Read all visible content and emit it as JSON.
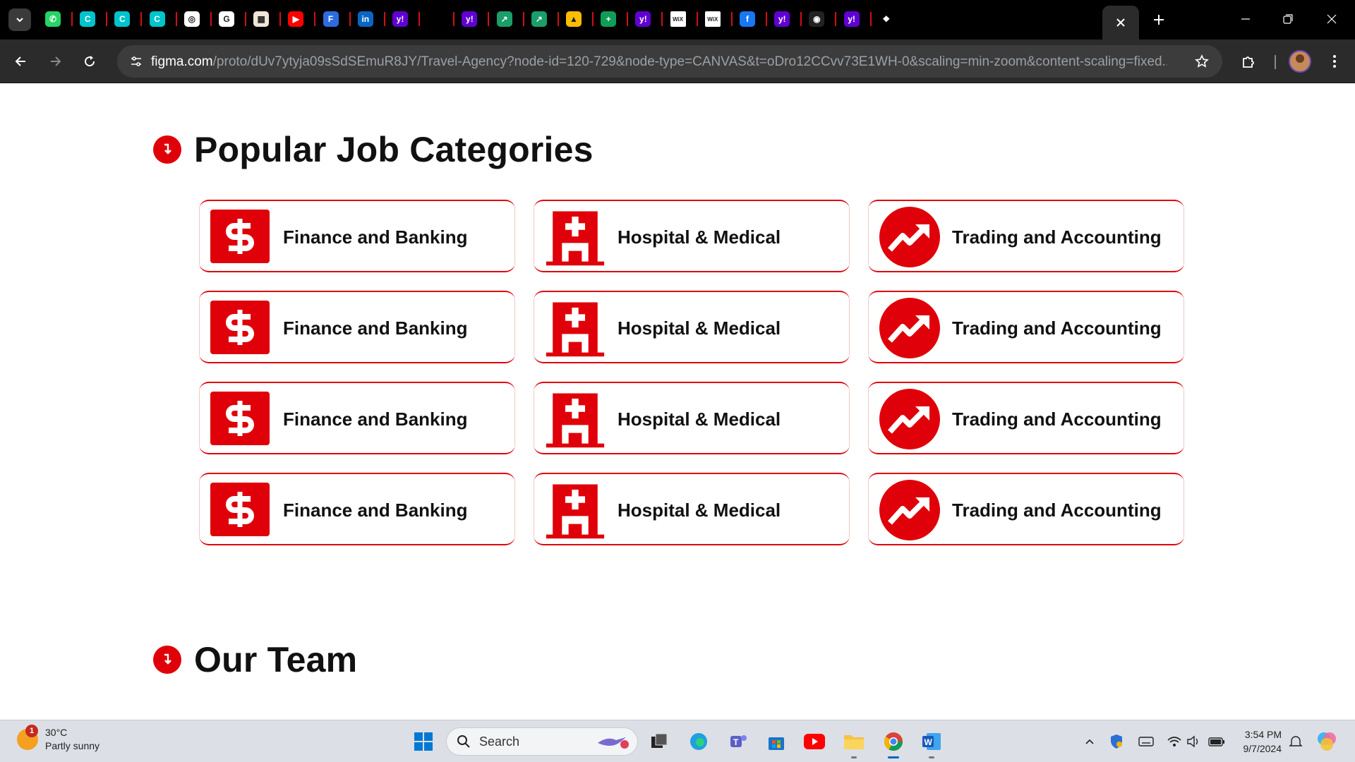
{
  "browser": {
    "url_host": "figma.com",
    "url_path": "/proto/dUv7ytyja09sSdSEmuR8JY/Travel-Agency?node-id=120-729&node-type=CANVAS&t=oDro12CCvv73E1WH-0&scaling=min-zoom&content-scaling=fixed...",
    "tabs": [
      {
        "icon": "whatsapp-icon",
        "color": "#25d366",
        "glyph": "✆"
      },
      {
        "icon": "canva-icon",
        "color": "#00c4cc",
        "glyph": "C"
      },
      {
        "icon": "canva-icon",
        "color": "#00c4cc",
        "glyph": "C"
      },
      {
        "icon": "canva-icon",
        "color": "#00c4cc",
        "glyph": "C"
      },
      {
        "icon": "chatgpt-icon",
        "color": "#ffffff",
        "glyph": "◎"
      },
      {
        "icon": "google-icon",
        "color": "#ffffff",
        "glyph": "G"
      },
      {
        "icon": "image-icon",
        "color": "#f0e6d8",
        "glyph": "▦"
      },
      {
        "icon": "youtube-icon",
        "color": "#ff0000",
        "glyph": "▶"
      },
      {
        "icon": "forms-icon",
        "color": "#2d6cdf",
        "glyph": "F"
      },
      {
        "icon": "linkedin-icon",
        "color": "#0a66c2",
        "glyph": "in"
      },
      {
        "icon": "yahoo-icon",
        "color": "#6001d2",
        "glyph": "y!"
      },
      {
        "icon": "blank-icon",
        "color": "#000000",
        "glyph": ""
      },
      {
        "icon": "yahoo-icon",
        "color": "#6001d2",
        "glyph": "y!"
      },
      {
        "icon": "trend-icon",
        "color": "#1a9e6a",
        "glyph": "↗"
      },
      {
        "icon": "trend-icon",
        "color": "#1a9e6a",
        "glyph": "↗"
      },
      {
        "icon": "google-drive-icon",
        "color": "#fbbc04",
        "glyph": "▲"
      },
      {
        "icon": "sheets-icon",
        "color": "#0f9d58",
        "glyph": "+"
      },
      {
        "icon": "yahoo-icon",
        "color": "#6001d2",
        "glyph": "y!"
      },
      {
        "icon": "wix-icon",
        "color": "#ffffff",
        "glyph": "WiX"
      },
      {
        "icon": "wix-icon",
        "color": "#ffffff",
        "glyph": "WiX"
      },
      {
        "icon": "facebook-icon",
        "color": "#1877f2",
        "glyph": "f"
      },
      {
        "icon": "yahoo-icon",
        "color": "#6001d2",
        "glyph": "y!"
      },
      {
        "icon": "github-icon",
        "color": "#222222",
        "glyph": "◉"
      },
      {
        "icon": "yahoo-icon",
        "color": "#6001d2",
        "glyph": "y!"
      },
      {
        "icon": "figma-icon",
        "color": "#000000",
        "glyph": "❖"
      }
    ]
  },
  "page": {
    "section1_title": "Popular Job Categories",
    "section2_title": "Our Team",
    "accent": "#e0000a",
    "categories": [
      {
        "label": "Finance and Banking",
        "icon": "dollar-icon"
      },
      {
        "label": "Hospital & Medical",
        "icon": "hospital-icon"
      },
      {
        "label": "Trading and Accounting",
        "icon": "trending-up-icon"
      },
      {
        "label": "Finance and Banking",
        "icon": "dollar-icon"
      },
      {
        "label": "Hospital & Medical",
        "icon": "hospital-icon"
      },
      {
        "label": "Trading and Accounting",
        "icon": "trending-up-icon"
      },
      {
        "label": "Finance and Banking",
        "icon": "dollar-icon"
      },
      {
        "label": "Hospital & Medical",
        "icon": "hospital-icon"
      },
      {
        "label": "Trading and Accounting",
        "icon": "trending-up-icon"
      },
      {
        "label": "Finance and Banking",
        "icon": "dollar-icon"
      },
      {
        "label": "Hospital & Medical",
        "icon": "hospital-icon"
      },
      {
        "label": "Trading and Accounting",
        "icon": "trending-up-icon"
      }
    ]
  },
  "taskbar": {
    "weather_temp": "30°C",
    "weather_desc": "Partly sunny",
    "weather_badge": "1",
    "search_placeholder": "Search",
    "time": "3:54 PM",
    "date": "9/7/2024"
  }
}
